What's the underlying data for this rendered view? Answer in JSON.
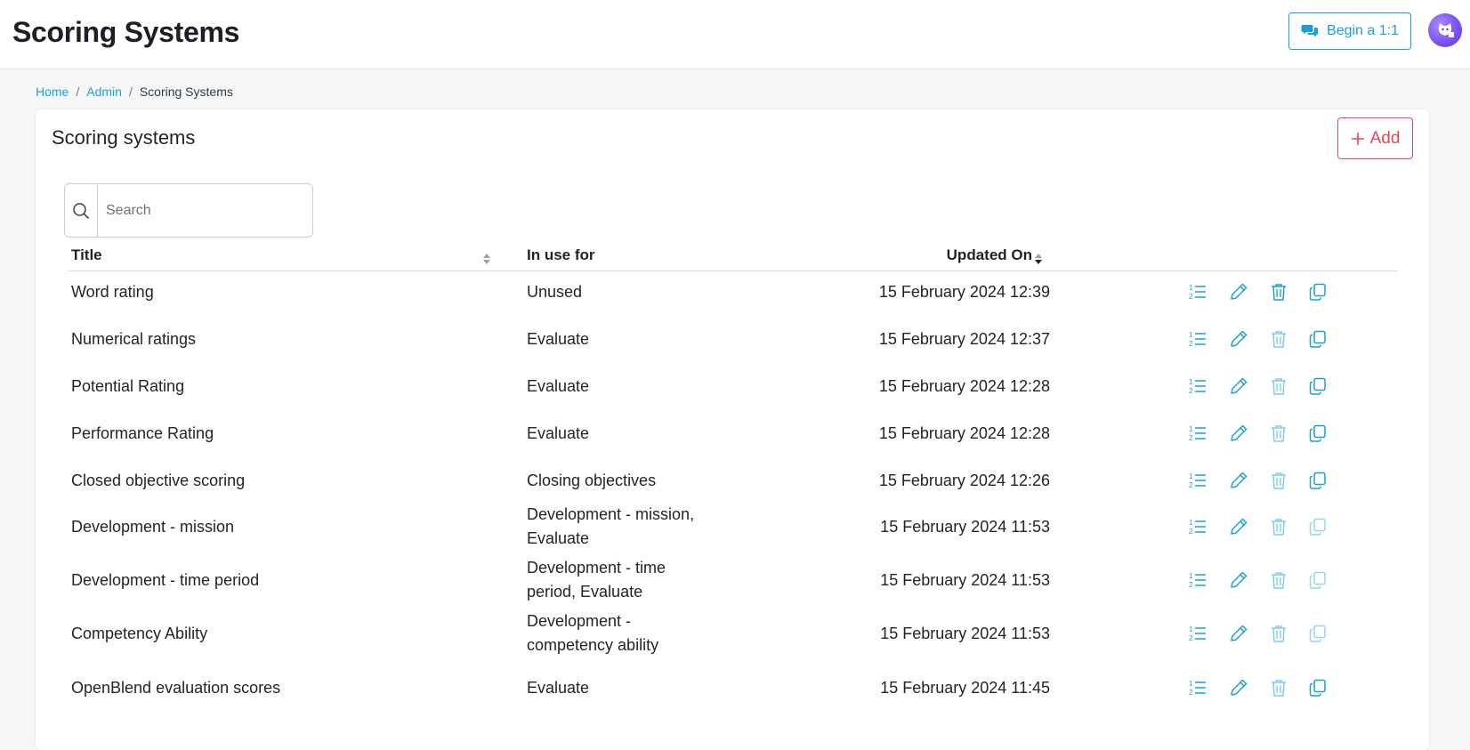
{
  "header": {
    "title": "Scoring Systems",
    "begin_label": "Begin a 1:1",
    "accent": "#1a9fd9"
  },
  "breadcrumb": {
    "home": "Home",
    "admin": "Admin",
    "current": "Scoring Systems",
    "separator": "/"
  },
  "card": {
    "title": "Scoring systems",
    "add_label": "Add"
  },
  "search": {
    "placeholder": "Search",
    "value": ""
  },
  "table": {
    "columns": {
      "title": "Title",
      "in_use": "In use for",
      "updated": "Updated On"
    },
    "sorted_column": "Updated On",
    "sort_direction": "descending",
    "rows": [
      {
        "title": "Word rating",
        "in_use": "Unused",
        "updated": "15 February 2024 12:39",
        "delete_enabled": true
      },
      {
        "title": "Numerical ratings",
        "in_use": "Evaluate",
        "updated": "15 February 2024 12:37",
        "delete_enabled": false
      },
      {
        "title": "Potential Rating",
        "in_use": "Evaluate",
        "updated": "15 February 2024 12:28",
        "delete_enabled": false
      },
      {
        "title": "Performance Rating",
        "in_use": "Evaluate",
        "updated": "15 February 2024 12:28",
        "delete_enabled": false
      },
      {
        "title": "Closed objective scoring",
        "in_use": "Closing objectives",
        "updated": "15 February 2024 12:26",
        "delete_enabled": false
      },
      {
        "title": "Development - mission",
        "in_use": "Development - mission, Evaluate",
        "updated": "15 February 2024 11:53",
        "delete_enabled": false
      },
      {
        "title": "Development - time period",
        "in_use": "Development - time period, Evaluate",
        "updated": "15 February 2024 11:53",
        "delete_enabled": false
      },
      {
        "title": "Competency Ability",
        "in_use": "Development - competency ability",
        "updated": "15 February 2024 11:53",
        "delete_enabled": false
      },
      {
        "title": "OpenBlend evaluation scores",
        "in_use": "Evaluate",
        "updated": "15 February 2024 11:45",
        "delete_enabled": false
      }
    ],
    "row_actions": [
      "list-icon",
      "pencil-icon",
      "trash-icon",
      "copy-icon"
    ]
  }
}
